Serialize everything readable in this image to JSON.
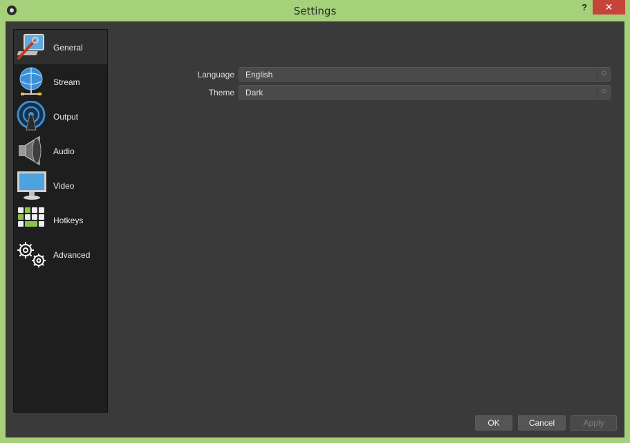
{
  "window": {
    "title": "Settings",
    "help_label": "?",
    "close_label": "✕"
  },
  "sidebar": {
    "items": [
      {
        "label": "General",
        "icon": "general-icon"
      },
      {
        "label": "Stream",
        "icon": "globe-network-icon"
      },
      {
        "label": "Output",
        "icon": "broadcast-icon"
      },
      {
        "label": "Audio",
        "icon": "speaker-icon"
      },
      {
        "label": "Video",
        "icon": "monitor-icon"
      },
      {
        "label": "Hotkeys",
        "icon": "keyboard-icon"
      },
      {
        "label": "Advanced",
        "icon": "gears-icon"
      }
    ],
    "active": "General"
  },
  "general": {
    "language_label": "Language",
    "language_value": "English",
    "theme_label": "Theme",
    "theme_value": "Dark"
  },
  "buttons": {
    "ok": "OK",
    "cancel": "Cancel",
    "apply": "Apply"
  }
}
